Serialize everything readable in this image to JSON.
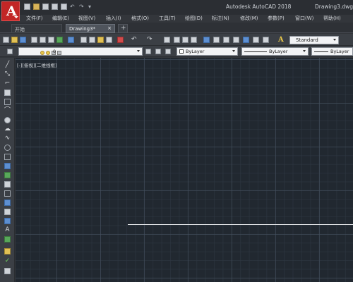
{
  "app": {
    "title": "Autodesk AutoCAD 2018",
    "document": "Drawing3.dwg",
    "logo_letter": "A"
  },
  "menu": {
    "items": [
      "文件(F)",
      "编辑(E)",
      "视图(V)",
      "插入(I)",
      "格式(O)",
      "工具(T)",
      "绘图(D)",
      "标注(N)",
      "修改(M)",
      "参数(P)",
      "窗口(W)",
      "帮助(H)"
    ]
  },
  "tabs": {
    "start": "开始",
    "drawing": "Drawing3*",
    "close_glyph": "×",
    "add_glyph": "+"
  },
  "toolbar": {
    "text_style": "Standard"
  },
  "layers": {
    "current_layer": "0",
    "color": "ByLayer",
    "linetype": "ByLayer",
    "lineweight": "ByLayer"
  },
  "canvas": {
    "viewport_label": "[-][俯视][二维线框]"
  },
  "colors": {
    "accent": "#c22626",
    "canvas_bg": "#212830",
    "drawn_line": "#e6e8ea"
  }
}
